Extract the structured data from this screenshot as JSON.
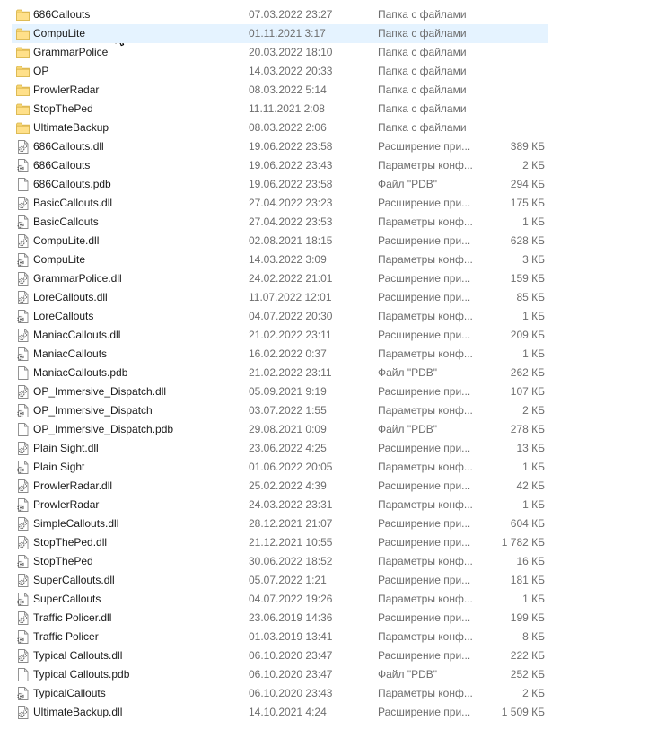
{
  "files": [
    {
      "name": "686Callouts",
      "date": "07.03.2022 23:27",
      "type": "Папка с файлами",
      "size": "",
      "icon": "folder-icon"
    },
    {
      "name": "CompuLite",
      "date": "01.11.2021 3:17",
      "type": "Папка с файлами",
      "size": "",
      "icon": "folder-icon",
      "selected": true
    },
    {
      "name": "GrammarPolice",
      "date": "20.03.2022 18:10",
      "type": "Папка с файлами",
      "size": "",
      "icon": "folder-icon"
    },
    {
      "name": "OP",
      "date": "14.03.2022 20:33",
      "type": "Папка с файлами",
      "size": "",
      "icon": "folder-icon"
    },
    {
      "name": "ProwlerRadar",
      "date": "08.03.2022 5:14",
      "type": "Папка с файлами",
      "size": "",
      "icon": "folder-icon"
    },
    {
      "name": "StopThePed",
      "date": "11.11.2021 2:08",
      "type": "Папка с файлами",
      "size": "",
      "icon": "folder-icon"
    },
    {
      "name": "UltimateBackup",
      "date": "08.03.2022 2:06",
      "type": "Папка с файлами",
      "size": "",
      "icon": "folder-icon"
    },
    {
      "name": "686Callouts.dll",
      "date": "19.06.2022 23:58",
      "type": "Расширение при...",
      "size": "389 КБ",
      "icon": "dll-file-icon"
    },
    {
      "name": "686Callouts",
      "date": "19.06.2022 23:43",
      "type": "Параметры конф...",
      "size": "2 КБ",
      "icon": "config-file-icon"
    },
    {
      "name": "686Callouts.pdb",
      "date": "19.06.2022 23:58",
      "type": "Файл \"PDB\"",
      "size": "294 КБ",
      "icon": "blank-file-icon"
    },
    {
      "name": "BasicCallouts.dll",
      "date": "27.04.2022 23:23",
      "type": "Расширение при...",
      "size": "175 КБ",
      "icon": "dll-file-icon"
    },
    {
      "name": "BasicCallouts",
      "date": "27.04.2022 23:53",
      "type": "Параметры конф...",
      "size": "1 КБ",
      "icon": "config-file-icon"
    },
    {
      "name": "CompuLite.dll",
      "date": "02.08.2021 18:15",
      "type": "Расширение при...",
      "size": "628 КБ",
      "icon": "dll-file-icon"
    },
    {
      "name": "CompuLite",
      "date": "14.03.2022 3:09",
      "type": "Параметры конф...",
      "size": "3 КБ",
      "icon": "config-file-icon"
    },
    {
      "name": "GrammarPolice.dll",
      "date": "24.02.2022 21:01",
      "type": "Расширение при...",
      "size": "159 КБ",
      "icon": "dll-file-icon"
    },
    {
      "name": "LoreCallouts.dll",
      "date": "11.07.2022 12:01",
      "type": "Расширение при...",
      "size": "85 КБ",
      "icon": "dll-file-icon"
    },
    {
      "name": "LoreCallouts",
      "date": "04.07.2022 20:30",
      "type": "Параметры конф...",
      "size": "1 КБ",
      "icon": "config-file-icon"
    },
    {
      "name": "ManiacCallouts.dll",
      "date": "21.02.2022 23:11",
      "type": "Расширение при...",
      "size": "209 КБ",
      "icon": "dll-file-icon"
    },
    {
      "name": "ManiacCallouts",
      "date": "16.02.2022 0:37",
      "type": "Параметры конф...",
      "size": "1 КБ",
      "icon": "config-file-icon"
    },
    {
      "name": "ManiacCallouts.pdb",
      "date": "21.02.2022 23:11",
      "type": "Файл \"PDB\"",
      "size": "262 КБ",
      "icon": "blank-file-icon"
    },
    {
      "name": "OP_Immersive_Dispatch.dll",
      "date": "05.09.2021 9:19",
      "type": "Расширение при...",
      "size": "107 КБ",
      "icon": "dll-file-icon"
    },
    {
      "name": "OP_Immersive_Dispatch",
      "date": "03.07.2022 1:55",
      "type": "Параметры конф...",
      "size": "2 КБ",
      "icon": "config-file-icon"
    },
    {
      "name": "OP_Immersive_Dispatch.pdb",
      "date": "29.08.2021 0:09",
      "type": "Файл \"PDB\"",
      "size": "278 КБ",
      "icon": "blank-file-icon"
    },
    {
      "name": "Plain Sight.dll",
      "date": "23.06.2022 4:25",
      "type": "Расширение при...",
      "size": "13 КБ",
      "icon": "dll-file-icon"
    },
    {
      "name": "Plain Sight",
      "date": "01.06.2022 20:05",
      "type": "Параметры конф...",
      "size": "1 КБ",
      "icon": "config-file-icon"
    },
    {
      "name": "ProwlerRadar.dll",
      "date": "25.02.2022 4:39",
      "type": "Расширение при...",
      "size": "42 КБ",
      "icon": "dll-file-icon"
    },
    {
      "name": "ProwlerRadar",
      "date": "24.03.2022 23:31",
      "type": "Параметры конф...",
      "size": "1 КБ",
      "icon": "config-file-icon"
    },
    {
      "name": "SimpleCallouts.dll",
      "date": "28.12.2021 21:07",
      "type": "Расширение при...",
      "size": "604 КБ",
      "icon": "dll-file-icon"
    },
    {
      "name": "StopThePed.dll",
      "date": "21.12.2021 10:55",
      "type": "Расширение при...",
      "size": "1 782 КБ",
      "icon": "dll-file-icon"
    },
    {
      "name": "StopThePed",
      "date": "30.06.2022 18:52",
      "type": "Параметры конф...",
      "size": "16 КБ",
      "icon": "config-file-icon"
    },
    {
      "name": "SuperCallouts.dll",
      "date": "05.07.2022 1:21",
      "type": "Расширение при...",
      "size": "181 КБ",
      "icon": "dll-file-icon"
    },
    {
      "name": "SuperCallouts",
      "date": "04.07.2022 19:26",
      "type": "Параметры конф...",
      "size": "1 КБ",
      "icon": "config-file-icon"
    },
    {
      "name": "Traffic Policer.dll",
      "date": "23.06.2019 14:36",
      "type": "Расширение при...",
      "size": "199 КБ",
      "icon": "dll-file-icon"
    },
    {
      "name": "Traffic Policer",
      "date": "01.03.2019 13:41",
      "type": "Параметры конф...",
      "size": "8 КБ",
      "icon": "config-file-icon"
    },
    {
      "name": "Typical Callouts.dll",
      "date": "06.10.2020 23:47",
      "type": "Расширение при...",
      "size": "222 КБ",
      "icon": "dll-file-icon"
    },
    {
      "name": "Typical Callouts.pdb",
      "date": "06.10.2020 23:47",
      "type": "Файл \"PDB\"",
      "size": "252 КБ",
      "icon": "blank-file-icon"
    },
    {
      "name": "TypicalCallouts",
      "date": "06.10.2020 23:43",
      "type": "Параметры конф...",
      "size": "2 КБ",
      "icon": "config-file-icon"
    },
    {
      "name": "UltimateBackup.dll",
      "date": "14.10.2021 4:24",
      "type": "Расширение при...",
      "size": "1 509 КБ",
      "icon": "dll-file-icon"
    }
  ]
}
